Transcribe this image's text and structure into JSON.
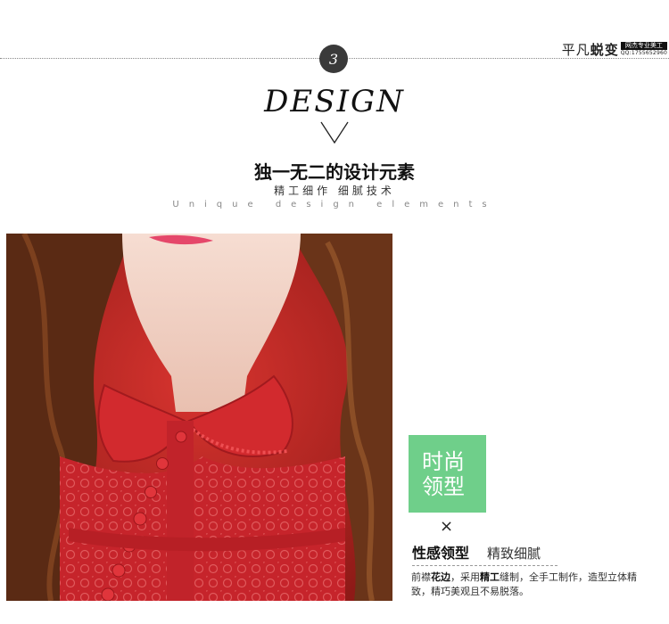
{
  "header": {
    "step_number": "3",
    "brand_main_light": "平凡",
    "brand_main_bold": "蜕变",
    "brand_tag": "网杰专业美工",
    "brand_qq": "QQ:1755652960"
  },
  "section": {
    "heading_en": "DESIGN",
    "heading_cn": "独一无二的设计元素",
    "subheading_cn": "精工细作  细腻技术",
    "subheading_en": "Unique design elements"
  },
  "feature": {
    "badge_line1": "时尚",
    "badge_line2": "领型",
    "times_symbol": "×",
    "title_bold": "性感领型",
    "title_light": "精致细腻",
    "desc_1": "前襟",
    "desc_1b": "花边",
    "desc_2": "，采用",
    "desc_2b": "精工",
    "desc_3": "缝制，全手工制作，造型立体精致，精巧美观且不易脱落。"
  },
  "colors": {
    "accent_green": "#6fcf8a",
    "dress_red": "#c8232a"
  }
}
